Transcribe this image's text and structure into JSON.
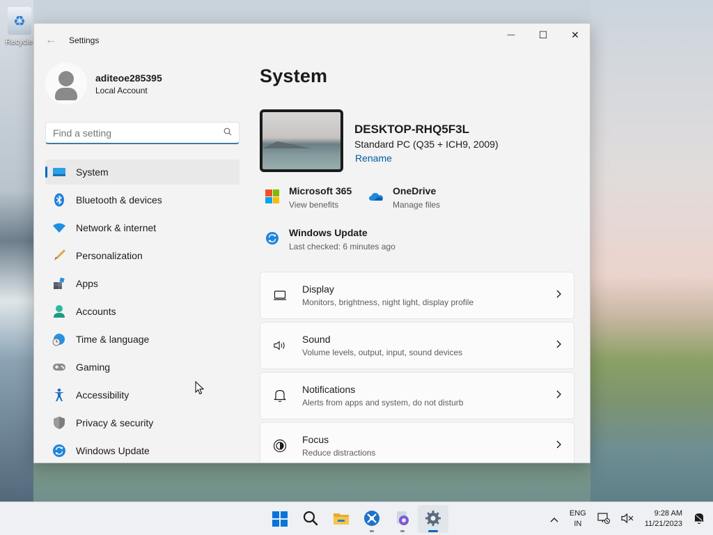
{
  "desktop": {
    "recycle_label": "Recycle"
  },
  "window": {
    "title": "Settings",
    "caption": {
      "minimize": "—",
      "maximize": "☐",
      "close": "✕"
    }
  },
  "profile": {
    "name": "aditeoe285395",
    "type": "Local Account"
  },
  "search": {
    "placeholder": "Find a setting"
  },
  "nav": {
    "items": [
      {
        "label": "System",
        "icon": "system-icon",
        "selected": true
      },
      {
        "label": "Bluetooth & devices",
        "icon": "bluetooth-icon"
      },
      {
        "label": "Network & internet",
        "icon": "wifi-icon"
      },
      {
        "label": "Personalization",
        "icon": "brush-icon"
      },
      {
        "label": "Apps",
        "icon": "apps-icon"
      },
      {
        "label": "Accounts",
        "icon": "accounts-icon"
      },
      {
        "label": "Time & language",
        "icon": "globe-clock-icon"
      },
      {
        "label": "Gaming",
        "icon": "gamepad-icon"
      },
      {
        "label": "Accessibility",
        "icon": "accessibility-icon"
      },
      {
        "label": "Privacy & security",
        "icon": "shield-icon"
      },
      {
        "label": "Windows Update",
        "icon": "update-icon"
      }
    ]
  },
  "main": {
    "title": "System",
    "pc": {
      "name": "DESKTOP-RHQ5F3L",
      "model": "Standard PC (Q35 + ICH9, 2009)",
      "rename": "Rename"
    },
    "quick": [
      {
        "title": "Microsoft 365",
        "sub": "View benefits"
      },
      {
        "title": "OneDrive",
        "sub": "Manage files"
      },
      {
        "title": "Windows Update",
        "sub": "Last checked: 6 minutes ago"
      }
    ],
    "cards": [
      {
        "title": "Display",
        "sub": "Monitors, brightness, night light, display profile"
      },
      {
        "title": "Sound",
        "sub": "Volume levels, output, input, sound devices"
      },
      {
        "title": "Notifications",
        "sub": "Alerts from apps and system, do not disturb"
      },
      {
        "title": "Focus",
        "sub": "Reduce distractions"
      }
    ]
  },
  "taskbar": {
    "lang_line1": "ENG",
    "lang_line2": "IN",
    "time": "9:28 AM",
    "date": "11/21/2023"
  },
  "colors": {
    "accent": "#0067c0",
    "link": "#005a9e"
  }
}
